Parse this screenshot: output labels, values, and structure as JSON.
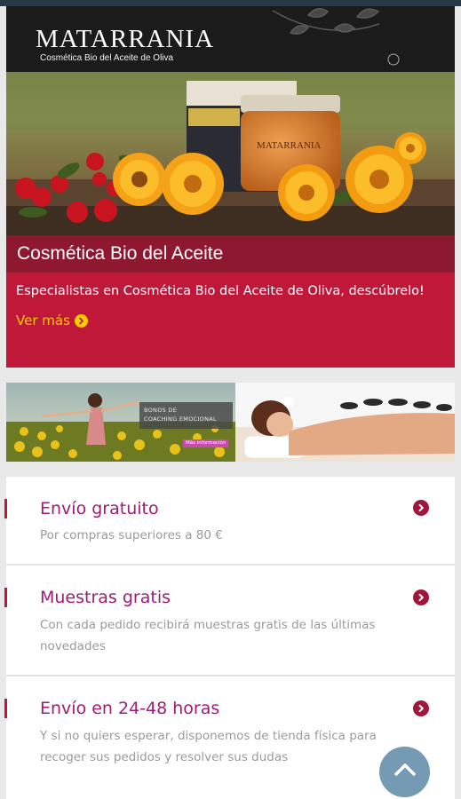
{
  "hero": {
    "brand_name": "MATARRANIA",
    "brand_tagline": "Cosmética Bio del Aceite de Oliva",
    "jar_label": "MATARRANIA",
    "title": "Cosmética Bio del Aceite",
    "description": "Especialistas en Cosmética Bio del Aceite de Oliva, descúbrelo!",
    "more_label": "Ver más",
    "more_icon": "chevron-circle-right-icon",
    "colors": {
      "accent": "#bf1839",
      "band": "#8e1830",
      "link": "#ffcc00"
    }
  },
  "banners": {
    "coaching_line1": "BONOS DE",
    "coaching_line2": "COACHING EMOCIONAL",
    "coaching_more": "Más información"
  },
  "features": [
    {
      "title": "Envío gratuito",
      "text": "Por compras superiores a 80 €",
      "icon": "chevron-circle-right-icon"
    },
    {
      "title": "Muestras gratis",
      "text": "Con cada pedido recibirá muestras gratis de las últimas novedades",
      "icon": "chevron-circle-right-icon"
    },
    {
      "title": "Envío en 24-48 horas",
      "text": "Y si no quiers esperar, disponemos de tienda física para recoger sus pedidos y resolver sus dudas",
      "icon": "chevron-circle-right-icon"
    }
  ],
  "scroll_top": {
    "icon": "chevron-up-icon"
  },
  "colors": {
    "feature_title": "#9f1b77",
    "feature_text": "#9a9a9a",
    "scroll_button": "#6d95b0"
  }
}
